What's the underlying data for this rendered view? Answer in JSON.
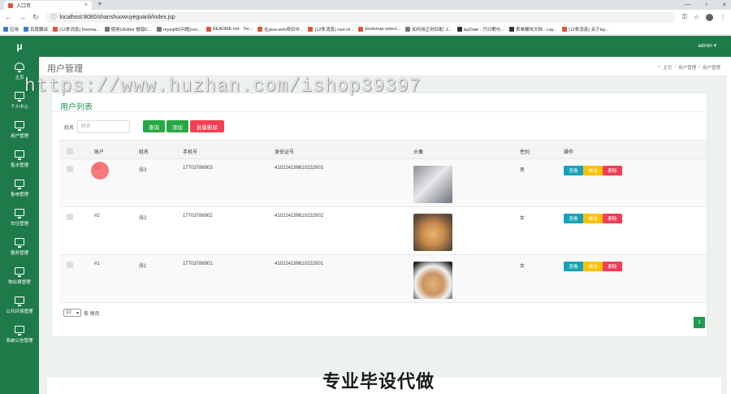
{
  "browser": {
    "tab_title": "入口页",
    "url": "localhost:8080/shanshuowuyeguanli/index.jsp",
    "bookmarks": [
      "应用",
      "百度翻译",
      "(12条消息) freema...",
      "使用UEditor 报错C...",
      "mysql8D问题(roo...",
      "README.md · Ter...",
      "在java web项目中...",
      "(12条消息) root of...",
      "bootstrap-select...",
      "如何用正则匹配: Z...",
      "layDate - 只日期与...",
      "表单模块文档 - Lay...",
      "(12条消息) 关于lay..."
    ]
  },
  "app": {
    "logo": "μ",
    "admin": "admin ▾",
    "sidebar": [
      "主页",
      "个人中心",
      "用户管理",
      "售水管理",
      "售电管理",
      "车位管理",
      "服务管理",
      "物业费管理",
      "公共环境管理",
      "系统公告管理"
    ],
    "page_title": "用户管理",
    "breadcrumb": [
      "主页",
      "用户管理",
      "用户管理"
    ]
  },
  "card": {
    "title": "用户列表",
    "search_label": "姓名",
    "search_placeholder": "姓名",
    "btn_query": "查询",
    "btn_add": "添加",
    "btn_batch_delete": "批量删除"
  },
  "table": {
    "headers": [
      "账户",
      "姓名",
      "手机号",
      "身份证号",
      "头像",
      "性别",
      "操作"
    ],
    "rows": [
      {
        "account": "#3",
        "name": "张3",
        "phone": "17703786903",
        "idcard": "410224199610232003",
        "gender": "男"
      },
      {
        "account": "#2",
        "name": "张2",
        "phone": "17703786902",
        "idcard": "410224199610232002",
        "gender": "女"
      },
      {
        "account": "#1",
        "name": "张1",
        "phone": "17703786901",
        "idcard": "410224199610232001",
        "gender": "女"
      }
    ],
    "ops": {
      "view": "查看",
      "edit": "修改",
      "delete": "删除"
    }
  },
  "pagination": {
    "page_size": "10",
    "page_size_suffix": "条 每页",
    "current_page": "1"
  },
  "watermark": {
    "url_text": "https://www.huzhan.com/ishop39397",
    "caption": "专业毕设代做"
  }
}
